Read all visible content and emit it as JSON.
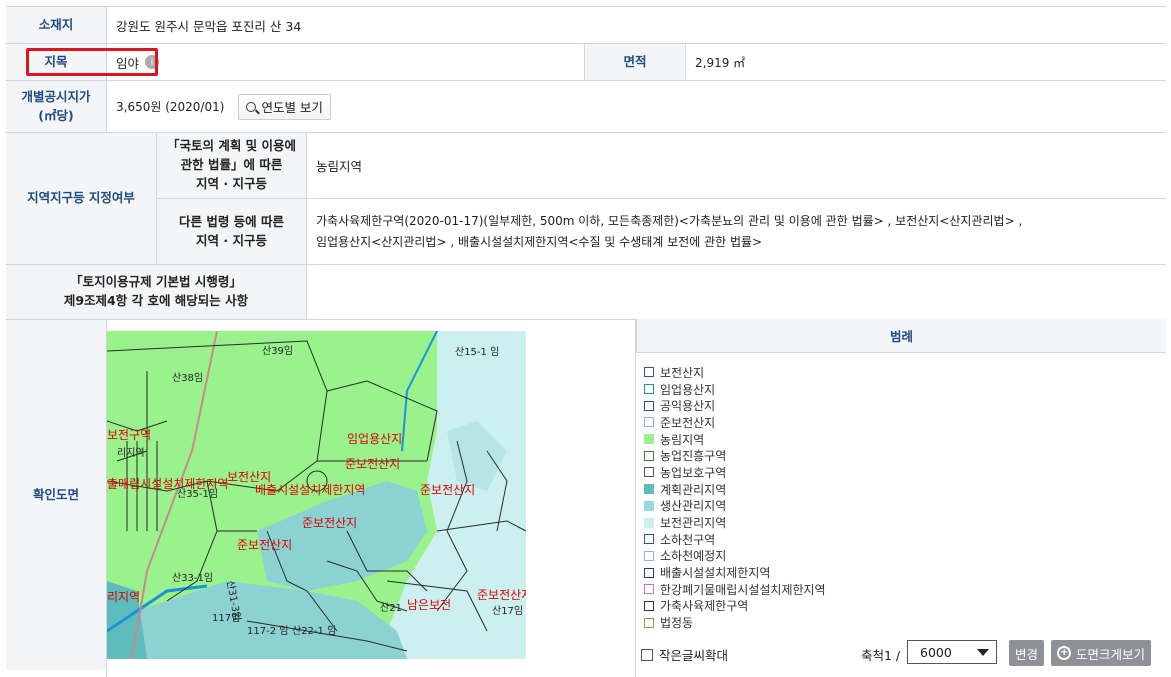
{
  "location": {
    "label": "소재지",
    "value": "강원도 원주시 문막읍 포진리 산 34"
  },
  "land_category": {
    "label": "지목",
    "value": "임야",
    "info": "i"
  },
  "area": {
    "label": "면적",
    "value": "2,919 ㎡"
  },
  "price": {
    "label_line1": "개별공시지가",
    "label_line2": "(㎡당)",
    "value": "3,650원 (2020/01)",
    "button": "연도별 보기"
  },
  "zoning": {
    "label": "지역지구등 지정여부",
    "national_law_label": [
      "「국토의 계획 및 이용에",
      "관한 법률」에 따른",
      "지역 · 지구등"
    ],
    "national_law_value": "농림지역",
    "other_law_label": [
      "다른 법령 등에 따른",
      "지역 · 지구등"
    ],
    "other_law_value_line1": "가축사육제한구역(2020-01-17)(일부제한, 500m 이하, 모든축종제한)<가축분뇨의 관리 및 이용에 관한 법률> , 보전산지<산지관리법> ,",
    "other_law_value_line2": "임업용산지<산지관리법> , 배출시설설치제한지역<수질 및 수생태계 보전에 관한 법률>"
  },
  "enforcement": {
    "label_line1": "「토지이용규제 기본법 시행령」",
    "label_line2": "제9조제4항 각 호에 해당되는 사항",
    "value": ""
  },
  "map": {
    "label": "확인도면",
    "parcel_labels": [
      "산39임",
      "산38임",
      "산15-1 임",
      "산35-1임",
      "임업용산지",
      "준보전산지",
      "보전산지",
      "배출시설설치제한지역",
      "보전산지",
      "준보전산지",
      "산31-3임",
      "산33-1임",
      "117임",
      "117-2 임",
      "산22-1 임",
      "산21",
      "산17임",
      "보전산지",
      "보전산지",
      "주보전산지",
      "준보전산지",
      "리지역",
      "보전구역"
    ],
    "colors": {
      "green": "#99f28c",
      "teal": "#8cd2d2",
      "cyan": "#ccefef",
      "lightteal": "#b7e4e4",
      "line": "#2a2a2a",
      "label": "#e00000"
    }
  },
  "legend": {
    "title": "범례",
    "items": [
      {
        "label": "보전산지",
        "color": "#ffffff",
        "border": "#2b5797"
      },
      {
        "label": "임업용산지",
        "color": "#ffffff",
        "border": "#2f8f8f"
      },
      {
        "label": "공익용산지",
        "color": "#ffffff",
        "border": "#2b5797"
      },
      {
        "label": "준보전산지",
        "color": "#ffffff",
        "border": "#7fbfbf"
      },
      {
        "label": "농림지역",
        "color": "#99f28c",
        "border": "#99f28c"
      },
      {
        "label": "농업진흥구역",
        "color": "#ffffff",
        "border": "#2e8b2e"
      },
      {
        "label": "농업보호구역",
        "color": "#ffffff",
        "border": "#446644"
      },
      {
        "label": "계획관리지역",
        "color": "#5fbcbc",
        "border": "#5fbcbc"
      },
      {
        "label": "생산관리지역",
        "color": "#9ad9d9",
        "border": "#9ad9d9"
      },
      {
        "label": "보전관리지역",
        "color": "#ccefef",
        "border": "#ccefef"
      },
      {
        "label": "소하천구역",
        "color": "#ffffff",
        "border": "#2b5797"
      },
      {
        "label": "소하천예정지",
        "color": "#ffffff",
        "border": "#7fbfbf"
      },
      {
        "label": "배출시설설치제한지역",
        "color": "#ffffff",
        "border": "#1f3f7f"
      },
      {
        "label": "한강폐기물매립시설설치제한지역",
        "color": "#ffffff",
        "border": "#d47a9a"
      },
      {
        "label": "가축사육제한구역",
        "color": "#ffffff",
        "border": "#333333"
      },
      {
        "label": "법정동",
        "color": "#ffffff",
        "border": "#b08a50"
      }
    ]
  },
  "controls": {
    "small_text_label": "작은글씨확대",
    "scale_label": "축척1 /",
    "scale_value": "6000",
    "change_button": "변경",
    "enlarge_button": "도면크게보기"
  }
}
